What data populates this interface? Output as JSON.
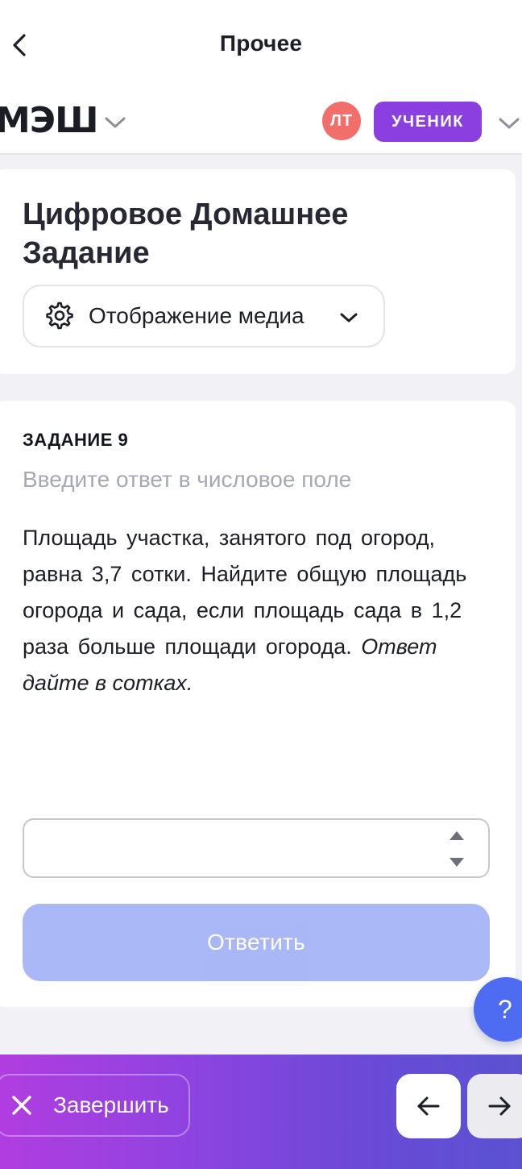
{
  "topbar": {
    "title": "Прочее",
    "back_icon": "chevron-left-icon"
  },
  "brand": {
    "logo_text": "МЭШ",
    "avatar_initials": "ЛТ",
    "role_label": "УЧЕНИК",
    "colors": {
      "avatar": "#f26e6a",
      "role_badge": "#8c3fe0"
    }
  },
  "homework": {
    "title": "Цифровое Домашнее Задание",
    "media_button_label": "Отображение медиа",
    "media_icon": "gear-icon"
  },
  "task": {
    "number_label": "ЗАДАНИЕ 9",
    "hint": "Введите ответ в числовое поле",
    "text_main": "Площадь участка, занятого под огород, равна 3,7 сотки. Найдите общую площадь огорода и сада, если площадь сада в 1,2 раза больше площади огорода.",
    "text_italic": "Ответ дайте в сотках.",
    "answer_value": "",
    "submit_label": "Ответить",
    "colors": {
      "submit_disabled": "#a5b4f7"
    }
  },
  "help": {
    "label": "?"
  },
  "footer": {
    "finish_label": "Завершить",
    "prev_icon": "arrow-left-icon",
    "next_icon": "arrow-right-icon",
    "colors": {
      "gradient_start": "#b13de0",
      "gradient_end": "#5b52d2"
    }
  }
}
